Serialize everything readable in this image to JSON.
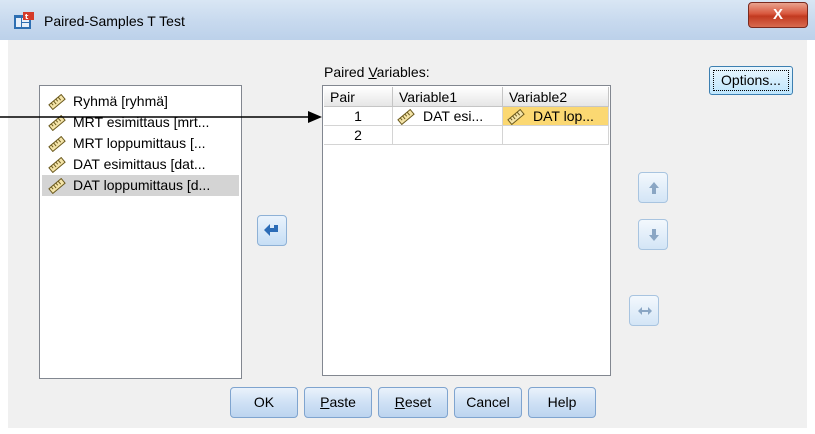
{
  "window": {
    "title": "Paired-Samples T Test",
    "close_label": "X"
  },
  "source_list": {
    "items": [
      {
        "label": "Ryhmä [ryhmä]",
        "selected": false
      },
      {
        "label": "MRT esimittaus [mrt...",
        "selected": false
      },
      {
        "label": "MRT loppumittaus [...",
        "selected": false
      },
      {
        "label": "DAT esimittaus [dat...",
        "selected": false
      },
      {
        "label": "DAT loppumittaus [d...",
        "selected": true
      }
    ]
  },
  "paired": {
    "label_prefix": "Paired ",
    "label_accel": "V",
    "label_suffix": "ariables:",
    "columns": [
      "Pair",
      "Variable1",
      "Variable2"
    ],
    "rows": [
      {
        "pair": "1",
        "var1": "DAT esi...",
        "var2": "DAT lop..."
      },
      {
        "pair": "2",
        "var1": "",
        "var2": ""
      }
    ]
  },
  "buttons": {
    "options": "Options...",
    "ok": "OK",
    "paste_accel": "P",
    "paste_rest": "aste",
    "reset_accel": "R",
    "reset_rest": "eset",
    "cancel": "Cancel",
    "help": "Help"
  },
  "colors": {
    "highlight": "#fbd872",
    "selection": "#d4d4d4",
    "accent": "#3c7fb1"
  },
  "icons": {
    "variable": "scale-ruler-icon",
    "move": "move-right-arrow-icon",
    "up": "move-up-arrow-icon",
    "down": "move-down-arrow-icon",
    "swap": "swap-arrows-icon"
  }
}
